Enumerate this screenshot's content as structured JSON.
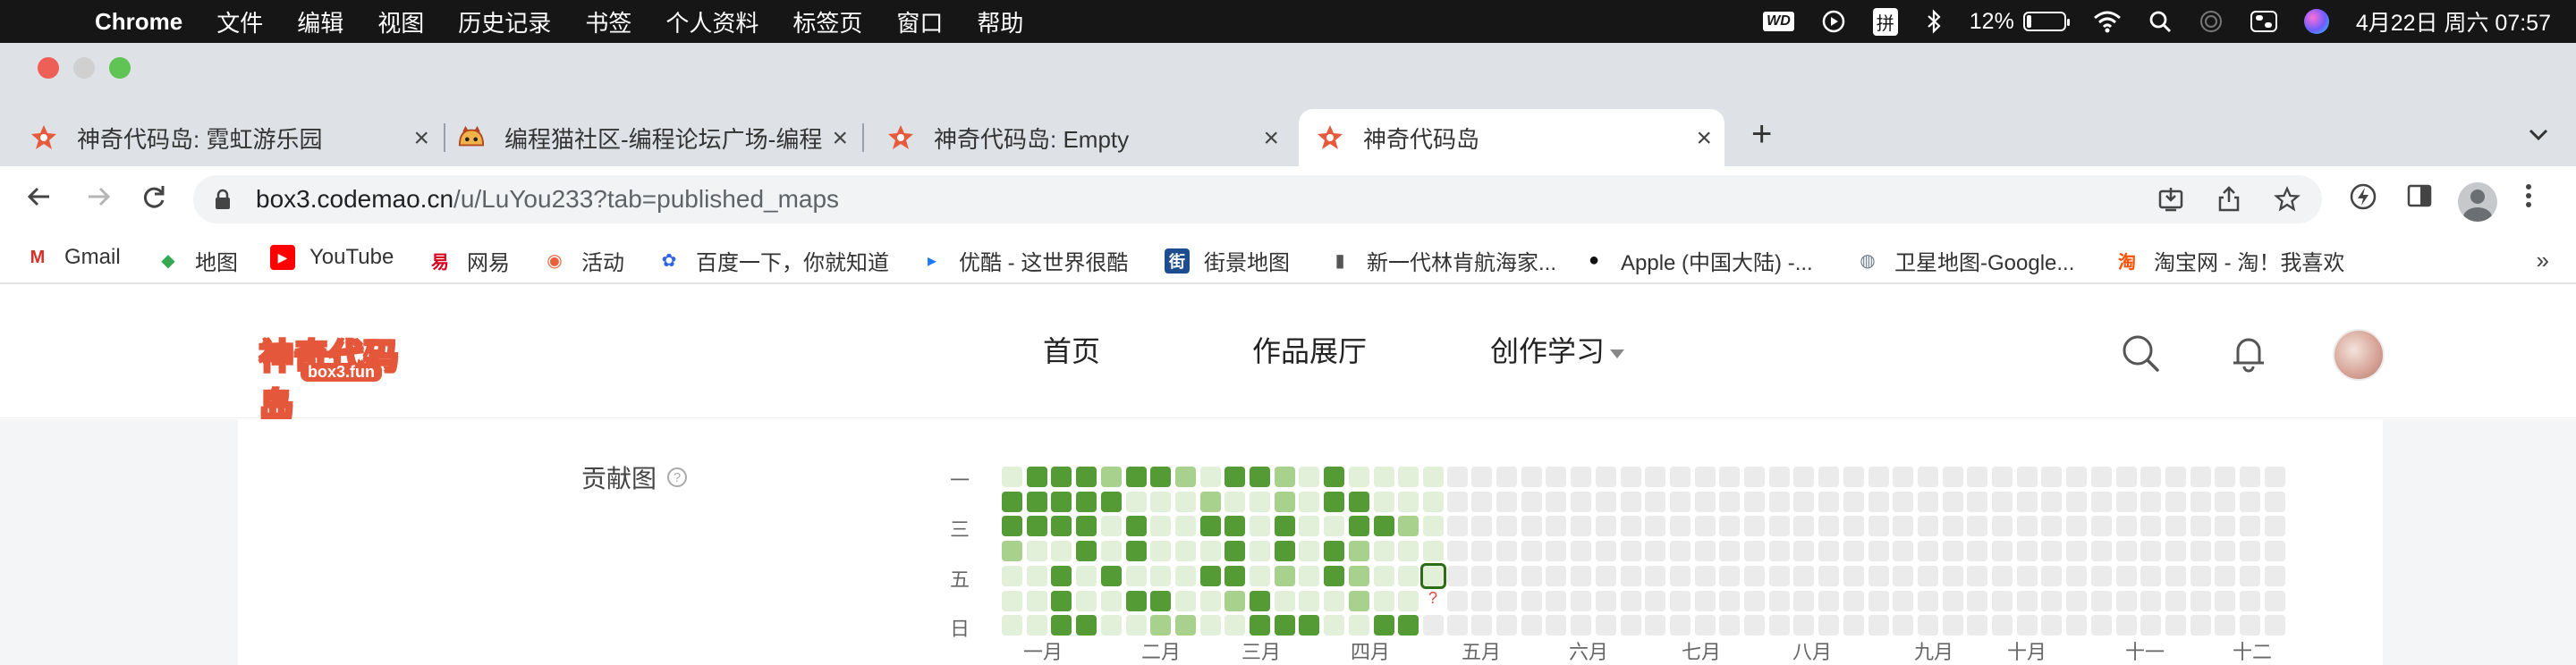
{
  "menubar": {
    "app": "Chrome",
    "menus": [
      "文件",
      "编辑",
      "视图",
      "历史记录",
      "书签",
      "个人资料",
      "标签页",
      "窗口",
      "帮助"
    ],
    "wd_badge": "WD",
    "input_method": "拼",
    "battery": "12%",
    "battery_level": 0.12,
    "datetime": "4月22日 周六  07:57"
  },
  "tabs": [
    {
      "title": "神奇代码岛: 霓虹游乐园",
      "favicon": "codemao-flower-icon"
    },
    {
      "title": "编程猫社区-编程论坛广场-编程学",
      "favicon": "codemao-cat-icon"
    },
    {
      "title": "神奇代码岛: Empty",
      "favicon": "codemao-flower-icon"
    },
    {
      "title": "神奇代码岛",
      "favicon": "codemao-flower-icon",
      "active": true
    }
  ],
  "omnibox": {
    "host": "box3.codemao.cn",
    "path": "/u/LuYou233?tab=published_maps"
  },
  "bookmarks": [
    {
      "label": "Gmail",
      "icon": "gmail-icon",
      "color": "#d93025",
      "glyph": "M"
    },
    {
      "label": "地图",
      "icon": "maps-icon",
      "color": "#34a853",
      "glyph": "◆"
    },
    {
      "label": "YouTube",
      "icon": "youtube-icon",
      "color": "#ff0000",
      "glyph": "▶"
    },
    {
      "label": "网易",
      "icon": "netease-icon",
      "color": "#d4001e",
      "glyph": "易"
    },
    {
      "label": "活动",
      "icon": "activity-icon",
      "color": "#e8613c",
      "glyph": "◉"
    },
    {
      "label": "百度一下，你就知道",
      "icon": "baidu-icon",
      "color": "#2f63e6",
      "glyph": "✿"
    },
    {
      "label": "优酷 - 这世界很酷",
      "icon": "youku-icon",
      "color": "#1e7bff",
      "glyph": "▸"
    },
    {
      "label": "街景地图",
      "icon": "street-view-icon",
      "color": "#1d4c8f",
      "glyph": "街"
    },
    {
      "label": "新一代林肯航海家...",
      "icon": "lincoln-icon",
      "color": "#555555",
      "glyph": "|"
    },
    {
      "label": "Apple (中国大陆) -...",
      "icon": "apple-icon",
      "color": "#111111",
      "glyph": "●"
    },
    {
      "label": "卫星地图-Google...",
      "icon": "globe-icon",
      "color": "#6b7b8c",
      "glyph": "◍"
    },
    {
      "label": "淘宝网 - 淘！我喜欢",
      "icon": "taobao-icon",
      "color": "#ff5000",
      "glyph": "淘"
    }
  ],
  "bookmarks_more": "»",
  "site": {
    "logo_text": "神奇代码岛",
    "logo_sub": "box3.fun",
    "nav": [
      "首页",
      "作品展厅",
      "创作学习"
    ],
    "contrib_label": "贡献图",
    "help": "?",
    "weekdays": [
      "一",
      "三",
      "五",
      "日"
    ],
    "months": [
      "一月",
      "二月",
      "三月",
      "四月",
      "五月",
      "六月",
      "七月",
      "八月",
      "九月",
      "十月",
      "十一",
      "十二"
    ],
    "today_mark": "?",
    "contribution_levels": [
      [
        1,
        3,
        3,
        2,
        1,
        1,
        1
      ],
      [
        3,
        3,
        3,
        1,
        1,
        1,
        1
      ],
      [
        3,
        3,
        3,
        1,
        3,
        3,
        3
      ],
      [
        3,
        3,
        3,
        3,
        1,
        1,
        3
      ],
      [
        2,
        3,
        1,
        1,
        3,
        1,
        1
      ],
      [
        3,
        1,
        3,
        3,
        1,
        3,
        1
      ],
      [
        3,
        1,
        1,
        1,
        1,
        3,
        2
      ],
      [
        2,
        1,
        1,
        1,
        1,
        1,
        2
      ],
      [
        1,
        2,
        3,
        1,
        3,
        1,
        1
      ],
      [
        3,
        1,
        3,
        3,
        3,
        2,
        1
      ],
      [
        3,
        1,
        1,
        1,
        1,
        3,
        3
      ],
      [
        2,
        2,
        3,
        3,
        2,
        1,
        3
      ],
      [
        1,
        1,
        1,
        1,
        1,
        1,
        3
      ],
      [
        3,
        3,
        1,
        3,
        3,
        1,
        1
      ],
      [
        1,
        3,
        3,
        2,
        2,
        2,
        1
      ],
      [
        1,
        1,
        3,
        1,
        1,
        1,
        3
      ],
      [
        1,
        1,
        2,
        1,
        1,
        1,
        3
      ],
      [
        1,
        1,
        1,
        1,
        1,
        1,
        1
      ]
    ],
    "total_weeks": 52,
    "today_week": 17,
    "today_day": 4
  }
}
